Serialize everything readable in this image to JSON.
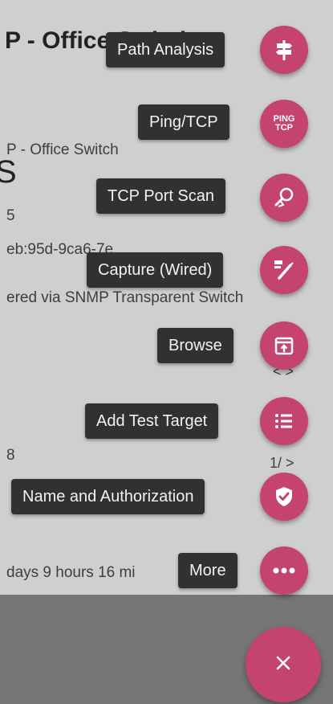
{
  "background": {
    "title": "P - Office Switch",
    "subtitle": "P - Office Switch",
    "partial_letter": "S",
    "id_fragment": "5",
    "mac_fragment": "eb:95d-9ca6-7e",
    "discovered_text": "ered via SNMP Transparent Switch",
    "row_fragment": "8",
    "uptime_text": "days 9 hours 16 mi",
    "arrows_1": "< >",
    "arrows_2": "1/ >"
  },
  "actions": [
    {
      "label": "Path Analysis",
      "icon": "signpost-icon"
    },
    {
      "label": "Ping/TCP",
      "icon": "ping-tcp-icon",
      "icon_text": [
        "PING",
        "TCP"
      ]
    },
    {
      "label": "TCP Port Scan",
      "icon": "port-scan-icon"
    },
    {
      "label": "Capture (Wired)",
      "icon": "capture-icon"
    },
    {
      "label": "Browse",
      "icon": "browse-icon"
    },
    {
      "label": "Add Test Target",
      "icon": "list-icon"
    },
    {
      "label": "Name and Authorization",
      "icon": "shield-check-icon"
    },
    {
      "label": "More",
      "icon": "more-icon"
    }
  ],
  "close_icon": "close-icon",
  "colors": {
    "fab": "#c5446f",
    "label_bg": "#2f3133",
    "scrim": "#7b7b7b"
  }
}
